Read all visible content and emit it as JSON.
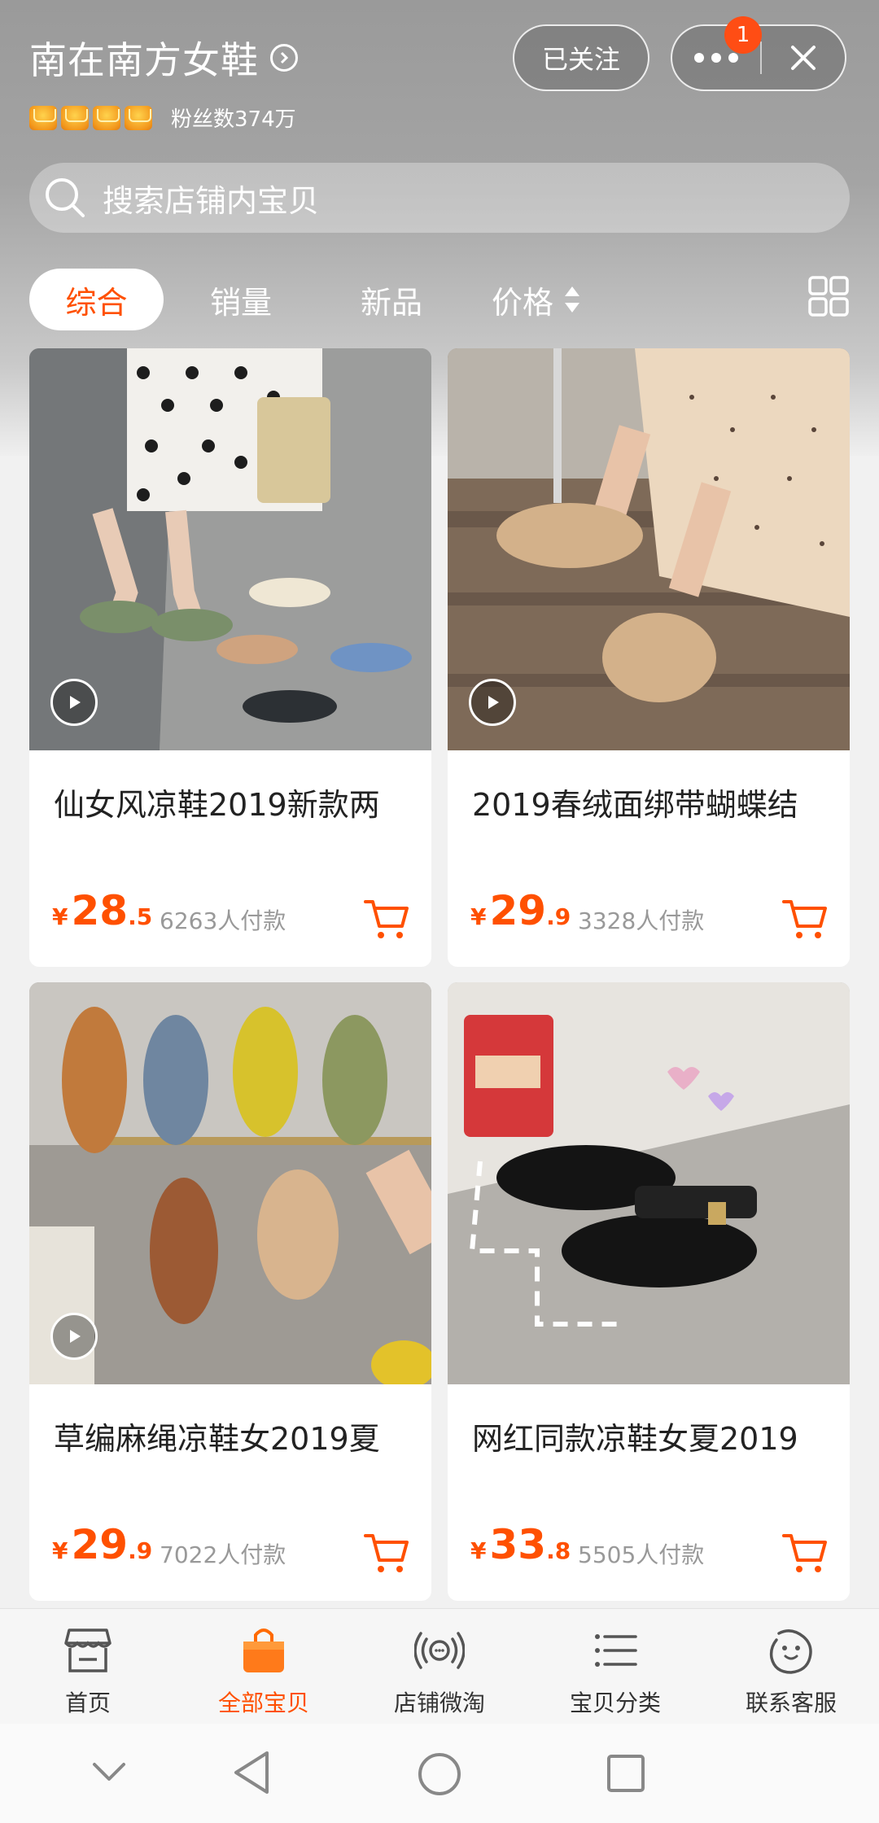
{
  "header": {
    "shop_name": "南在南方女鞋",
    "crown_count": 4,
    "fans_text": "粉丝数374万",
    "follow_label": "已关注",
    "notification_count": "1"
  },
  "search": {
    "placeholder": "搜索店铺内宝贝"
  },
  "sort_tabs": [
    {
      "label": "综合",
      "active": true
    },
    {
      "label": "销量",
      "active": false
    },
    {
      "label": "新品",
      "active": false
    },
    {
      "label": "价格",
      "active": false
    }
  ],
  "products": [
    {
      "title": "仙女风凉鞋2019新款两",
      "currency": "¥",
      "price_int": "28",
      "price_dec": ".5",
      "paid": "6263人付款",
      "has_video": true
    },
    {
      "title": "2019春绒面绑带蝴蝶结",
      "currency": "¥",
      "price_int": "29",
      "price_dec": ".9",
      "paid": "3328人付款",
      "has_video": true
    },
    {
      "title": "草编麻绳凉鞋女2019夏",
      "currency": "¥",
      "price_int": "29",
      "price_dec": ".9",
      "paid": "7022人付款",
      "has_video": true
    },
    {
      "title": "网红同款凉鞋女夏2019",
      "currency": "¥",
      "price_int": "33",
      "price_dec": ".8",
      "paid": "5505人付款",
      "has_video": false
    }
  ],
  "bottom_tabs": [
    {
      "label": "首页",
      "icon": "shop-icon",
      "active": false
    },
    {
      "label": "全部宝贝",
      "icon": "shopping-bag-icon",
      "active": true
    },
    {
      "label": "店铺微淘",
      "icon": "broadcast-icon",
      "active": false
    },
    {
      "label": "宝贝分类",
      "icon": "list-icon",
      "active": false
    },
    {
      "label": "联系客服",
      "icon": "service-face-icon",
      "active": false
    }
  ],
  "colors": {
    "accent": "#ff5000",
    "badge": "#ff4d14"
  }
}
